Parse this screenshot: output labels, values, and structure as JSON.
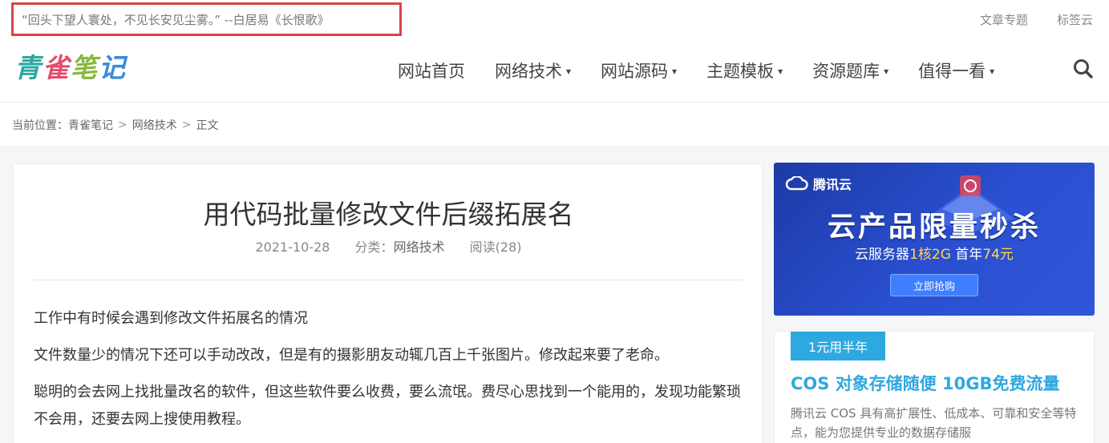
{
  "topbar": {
    "quote": "“回头下望人寰处，不见长安见尘雾。” --白居易《长恨歌》",
    "links": [
      "文章专题",
      "标签云"
    ],
    "highlight_color": "#d9434a"
  },
  "header": {
    "logo_chars": [
      "青",
      "雀",
      "笔",
      "记"
    ],
    "nav": [
      {
        "label": "网站首页",
        "has_dropdown": false
      },
      {
        "label": "网络技术",
        "has_dropdown": true
      },
      {
        "label": "网站源码",
        "has_dropdown": true
      },
      {
        "label": "主题模板",
        "has_dropdown": true
      },
      {
        "label": "资源题库",
        "has_dropdown": true
      },
      {
        "label": "值得一看",
        "has_dropdown": true
      }
    ],
    "search_icon": "search-icon"
  },
  "breadcrumb": {
    "prefix": "当前位置：",
    "items": [
      "青雀笔记",
      "网络技术",
      "正文"
    ],
    "separator": ">"
  },
  "article": {
    "title": "用代码批量修改文件后缀拓展名",
    "date": "2021-10-28",
    "category_prefix": "分类：",
    "category": "网络技术",
    "reads": "阅读(28)",
    "paragraphs": [
      "工作中有时候会遇到修改文件拓展名的情况",
      "文件数量少的情况下还可以手动改改，但是有的摄影朋友动辄几百上千张图片。修改起来要了老命。",
      "聪明的会去网上找批量改名的软件，但这些软件要么收费，要么流氓。费尽心思找到一个能用的，发现功能繁琐不会用，还要去网上搜使用教程。"
    ]
  },
  "banner": {
    "brand": "腾讯云",
    "headline": "云产品限量秒杀",
    "sub_prefix": "云服务器",
    "sub_highlight1": "1核2G",
    "sub_mid": " 首年",
    "sub_highlight2": "74元",
    "button": "立即抢购"
  },
  "promo": {
    "badge": "1元用半年",
    "title": "COS 对象存储随便 10GB免费流量",
    "desc": "腾讯云 COS 具有高扩展性、低成本、可靠和安全等特点，能为您提供专业的数据存储服"
  }
}
